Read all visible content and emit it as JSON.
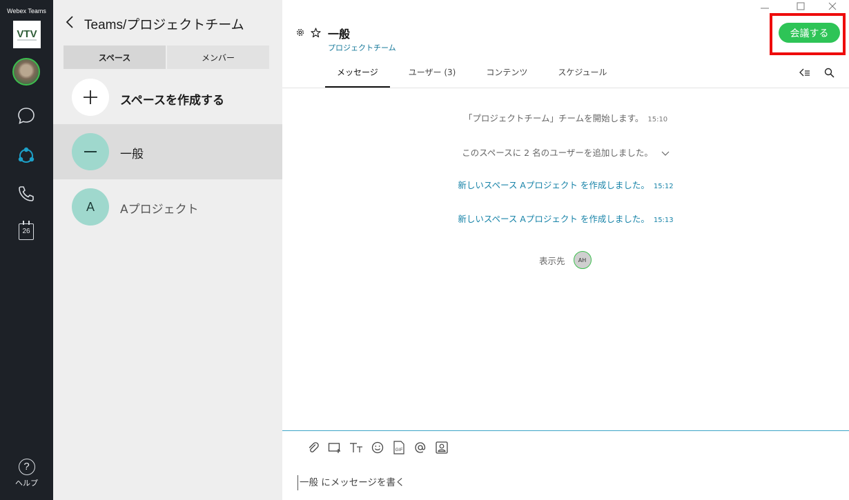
{
  "app": {
    "title": "Webex Teams",
    "logo_text": "VTV"
  },
  "rail": {
    "calendar_day": "26",
    "help_label": "ヘルプ",
    "accent": "#1da1c9"
  },
  "panel": {
    "team_title": "Teams/プロジェクトチーム",
    "tabs": [
      "スペース",
      "メンバー"
    ],
    "create_label": "スペースを作成する",
    "spaces": [
      {
        "badge": "—",
        "name": "一般",
        "selected": true
      },
      {
        "badge": "A",
        "name": "Aプロジェクト",
        "selected": false
      }
    ]
  },
  "main": {
    "space_title": "一般",
    "space_subtitle": "プロジェクトチーム",
    "meet_button": "会議する",
    "tabs": [
      "メッセージ",
      "ユーザー (3)",
      "コンテンツ",
      "スケジュール"
    ],
    "activity": [
      {
        "text": "「プロジェクトチーム」チームを開始します。",
        "time": "15:10"
      },
      {
        "text": "このスペースに 2 名のユーザーを追加しました。"
      },
      {
        "text": "新しいスペース Aプロジェクト を作成しました。",
        "time": "15:12"
      },
      {
        "text": "新しいスペース Aプロジェクト を作成しました。",
        "time": "15:13"
      }
    ],
    "seen_label": "表示先",
    "seen_avatar": "AH",
    "compose_placeholder": "一般 にメッセージを書く"
  },
  "colors": {
    "rail_bg": "#1d2127",
    "panel_bg": "#eeeeee",
    "meet_green": "#2ec457",
    "highlight_red": "#ee0c0c",
    "link_blue": "#1783a8"
  }
}
